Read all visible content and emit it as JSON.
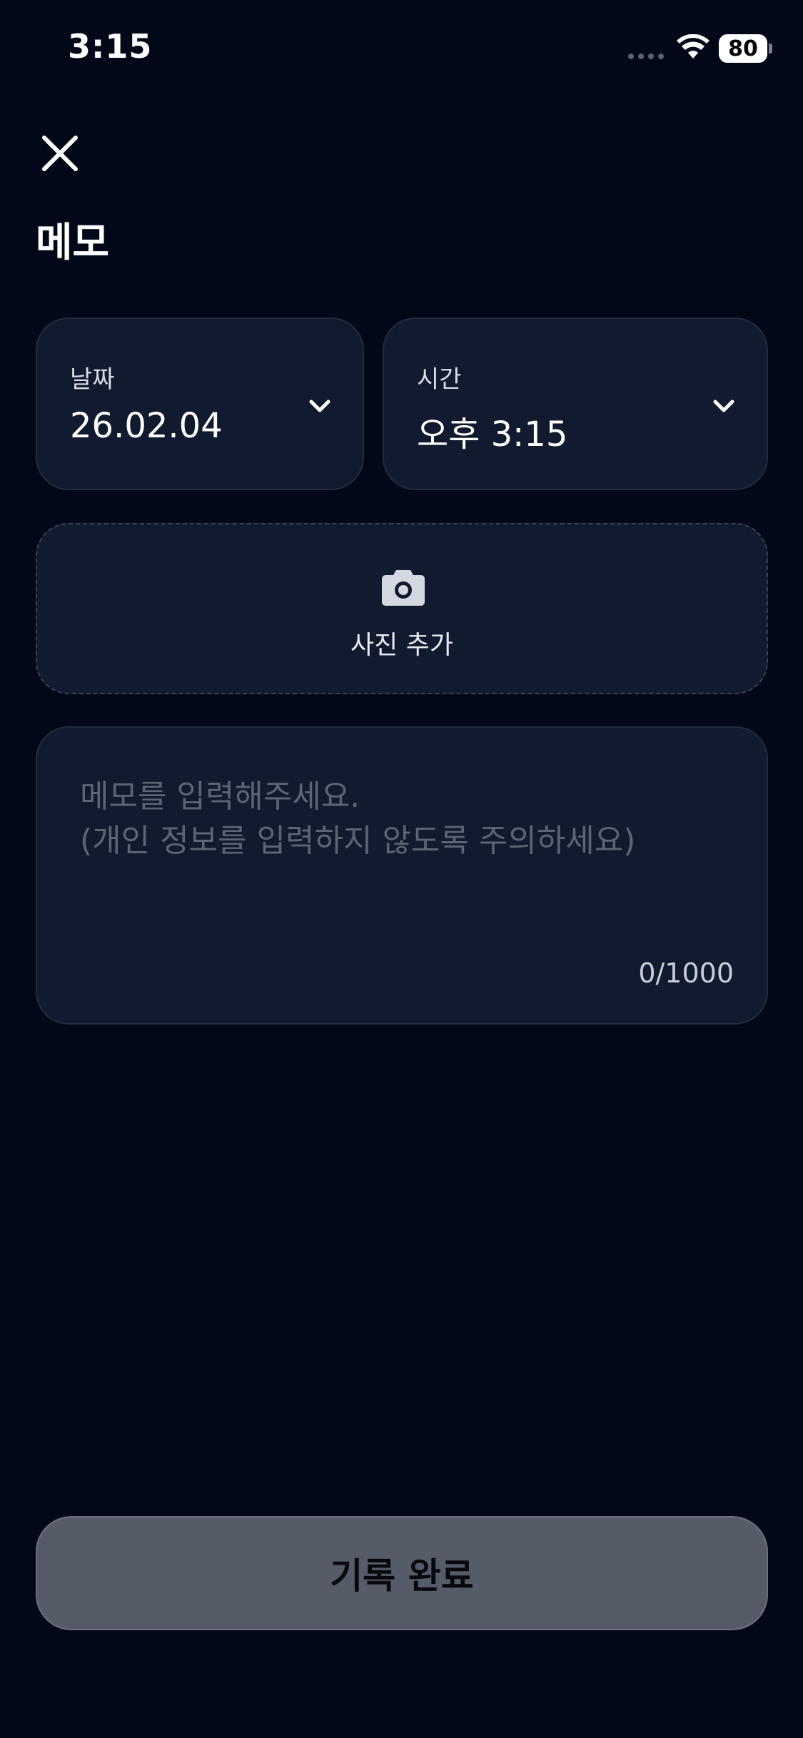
{
  "status_bar": {
    "time": "3:15",
    "battery": "80"
  },
  "header": {
    "title": "메모",
    "close_icon": "close-icon"
  },
  "pickers": {
    "date": {
      "label": "날짜",
      "value": "26.02.04",
      "icon": "chevron-down-icon"
    },
    "time": {
      "label": "시간",
      "value": "오후 3:15",
      "icon": "chevron-down-icon"
    }
  },
  "photo": {
    "label": "사진 추가",
    "icon": "camera-icon"
  },
  "memo": {
    "value": "",
    "placeholder": "메모를 입력해주세요.\n(개인 정보를 입력하지 않도록 주의하세요)",
    "count": "0/1000"
  },
  "submit": {
    "label": "기록 완료"
  },
  "colors": {
    "background": "#020817",
    "card": "#111a2e",
    "card_border": "#222c40",
    "button_disabled": "#565b68",
    "placeholder": "#5c6475"
  }
}
